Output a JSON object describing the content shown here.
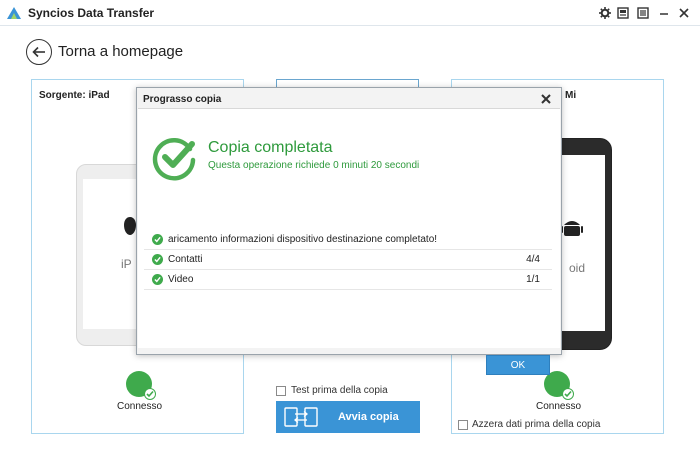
{
  "app": {
    "title": "Syncios Data Transfer"
  },
  "nav": {
    "back_label": "Torna a homepage"
  },
  "source_panel": {
    "header": "Sorgente: iPad",
    "device_partial_text": "iP",
    "status": "Connesso"
  },
  "target_panel": {
    "header_partial": "Mi",
    "device_partial_text": "oid",
    "status": "Connesso",
    "clear_label": "Azzera dati prima della copia"
  },
  "middle": {
    "test_label": "Test prima della copia",
    "start_label": "Avvia copia"
  },
  "dialog": {
    "title": "Prograsso copia",
    "heading": "Copia completata",
    "subheading": "Questa operazione richiede 0 minuti 20 secondi",
    "rows": [
      {
        "label": "aricamento informazioni dispositivo destinazione completato!",
        "count": ""
      },
      {
        "label": "Contatti",
        "count": "4/4"
      },
      {
        "label": "Video",
        "count": "1/1"
      }
    ],
    "ok_label": "OK"
  },
  "colors": {
    "accent": "#3a94d6",
    "success": "#2e9a3c",
    "panel_border": "#a9d6ee"
  }
}
